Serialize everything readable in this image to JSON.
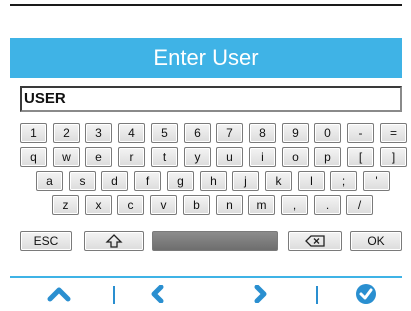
{
  "header": {
    "title": "Enter User"
  },
  "entry": {
    "value": "USER"
  },
  "keyboard": {
    "row1": [
      "1",
      "2",
      "3",
      "4",
      "5",
      "6",
      "7",
      "8",
      "9",
      "0",
      "-",
      "="
    ],
    "row2": [
      "q",
      "w",
      "e",
      "r",
      "t",
      "y",
      "u",
      "i",
      "o",
      "p",
      "[",
      "]"
    ],
    "row3": [
      "a",
      "s",
      "d",
      "f",
      "g",
      "h",
      "j",
      "k",
      "l",
      ";",
      "'"
    ],
    "row4": [
      "z",
      "x",
      "c",
      "v",
      "b",
      "n",
      "m",
      ",",
      ".",
      "/"
    ],
    "esc": "ESC",
    "ok": "OK"
  },
  "colors": {
    "accent": "#3fb3e6",
    "nav_icon": "#2a8fd0"
  },
  "nav": {
    "icons": [
      "chevron-up-icon",
      "chevron-left-icon",
      "chevron-right-icon",
      "check-circle-icon"
    ]
  }
}
